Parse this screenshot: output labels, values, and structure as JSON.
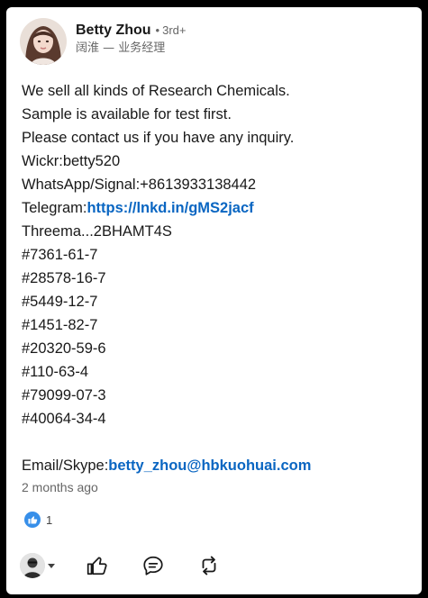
{
  "author": {
    "name": "Betty Zhou",
    "degree_separator": "•",
    "degree": "3rd+",
    "headline": "阔淮 — 业务经理"
  },
  "post": {
    "lines": [
      "We sell all kinds of Research Chemicals.",
      "Sample is available for test first.",
      "Please contact us if you have any inquiry.",
      "Wickr:betty520",
      "WhatsApp/Signal:+8613933138442"
    ],
    "telegram_prefix": "Telegram:",
    "telegram_link": "https://lnkd.in/gMS2jacf",
    "threema": "Threema...2BHAMT4S",
    "cas_numbers": [
      "#7361-61-7",
      "#28578-16-7",
      "#5449-12-7",
      "#1451-82-7",
      "#20320-59-6",
      "#110-63-4",
      "#79099-07-3",
      "#40064-34-4"
    ],
    "email_prefix": "Email/Skype:",
    "email_link": "betty_zhou@hbkuohuai.com"
  },
  "timestamp": "2 months ago",
  "reactions": {
    "icon": "like-icon",
    "count": "1"
  },
  "actions": {
    "icons": [
      "user-avatar-icon",
      "like-icon",
      "comment-icon",
      "repost-icon"
    ]
  },
  "colors": {
    "link": "#0a66c2",
    "like_badge": "#378fe9",
    "muted_text": "#666666",
    "background": "#000000"
  }
}
